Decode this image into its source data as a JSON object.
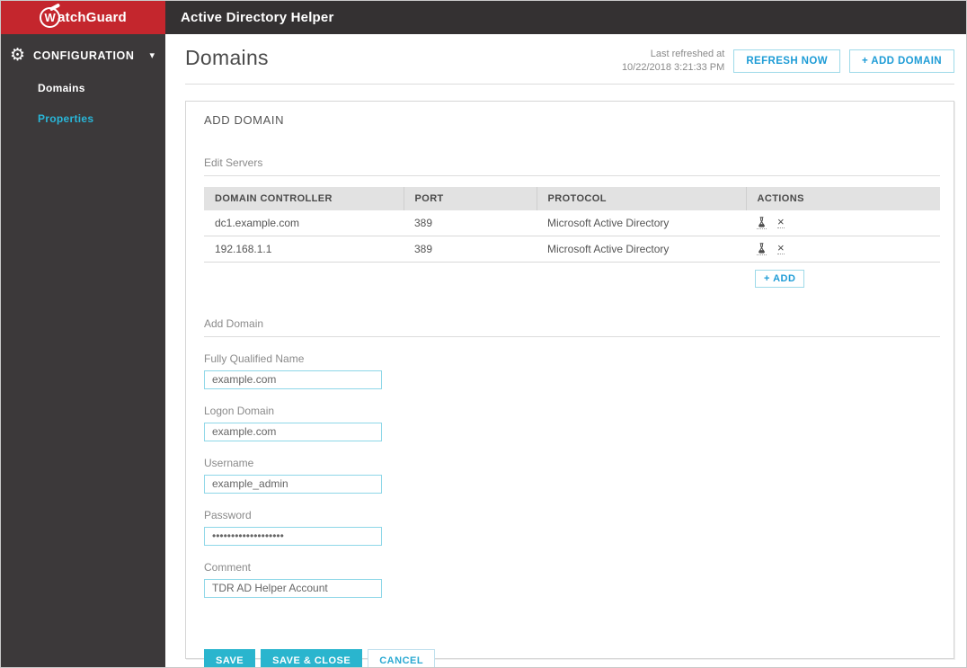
{
  "app": {
    "logo_w": "W",
    "logo_rest": "atchGuard",
    "title": "Active Directory Helper"
  },
  "sidebar": {
    "section_label": "CONFIGURATION",
    "items": [
      {
        "label": "Domains"
      },
      {
        "label": "Properties"
      }
    ]
  },
  "page": {
    "title": "Domains",
    "last_refreshed_label": "Last refreshed at",
    "last_refreshed_value": "10/22/2018 3:21:33 PM",
    "refresh_button": "REFRESH NOW",
    "add_domain_button": "+ ADD DOMAIN"
  },
  "card": {
    "title": "ADD DOMAIN",
    "edit_servers_label": "Edit Servers",
    "table": {
      "columns": [
        "DOMAIN CONTROLLER",
        "PORT",
        "PROTOCOL",
        "ACTIONS"
      ],
      "rows": [
        {
          "domain_controller": "dc1.example.com",
          "port": "389",
          "protocol": "Microsoft Active Directory"
        },
        {
          "domain_controller": "192.168.1.1",
          "port": "389",
          "protocol": "Microsoft Active Directory"
        }
      ]
    },
    "add_server_button": "+ ADD",
    "add_domain_label": "Add Domain",
    "fields": [
      {
        "label": "Fully Qualified Name",
        "value": "example.com"
      },
      {
        "label": "Logon Domain",
        "value": "example.com"
      },
      {
        "label": "Username",
        "value": "example_admin"
      },
      {
        "label": "Password",
        "value": "•••••••••••••••••••"
      },
      {
        "label": "Comment",
        "value": "TDR AD Helper Account"
      }
    ],
    "buttons": {
      "save": "SAVE",
      "save_close": "SAVE & CLOSE",
      "cancel": "CANCEL"
    }
  },
  "colors": {
    "brand_red": "#c4262d",
    "topbar_bg": "#343132",
    "sidebar_bg": "#3c393a",
    "accent_teal": "#2ab5ce",
    "accent_blue": "#1e9cd6",
    "sidebar_link_cyan": "#29b6d8",
    "input_border": "#8ed7e8",
    "table_header_bg": "#e2e2e2"
  }
}
